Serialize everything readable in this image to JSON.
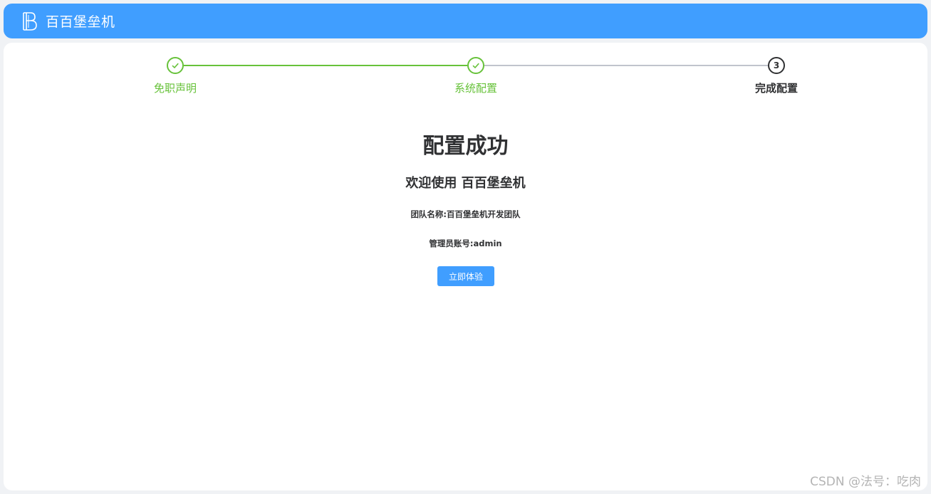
{
  "header": {
    "app_title": "百百堡垒机",
    "logo_icon": "bb-logo-icon"
  },
  "steps": [
    {
      "title": "免职声明",
      "status": "done",
      "icon": "check-icon"
    },
    {
      "title": "系统配置",
      "status": "done",
      "icon": "check-icon"
    },
    {
      "title": "完成配置",
      "status": "current",
      "number": "3"
    }
  ],
  "main": {
    "title": "配置成功",
    "subtitle": "欢迎使用 百百堡垒机",
    "team_line": "团队名称:百百堡垒机开发团队",
    "admin_line": "管理员账号:admin",
    "try_button": "立即体验"
  },
  "watermark": "CSDN @法号：吃肉",
  "colors": {
    "primary": "#409eff",
    "success": "#67c23a",
    "text": "#303133",
    "inactive": "#c0c4cc"
  }
}
